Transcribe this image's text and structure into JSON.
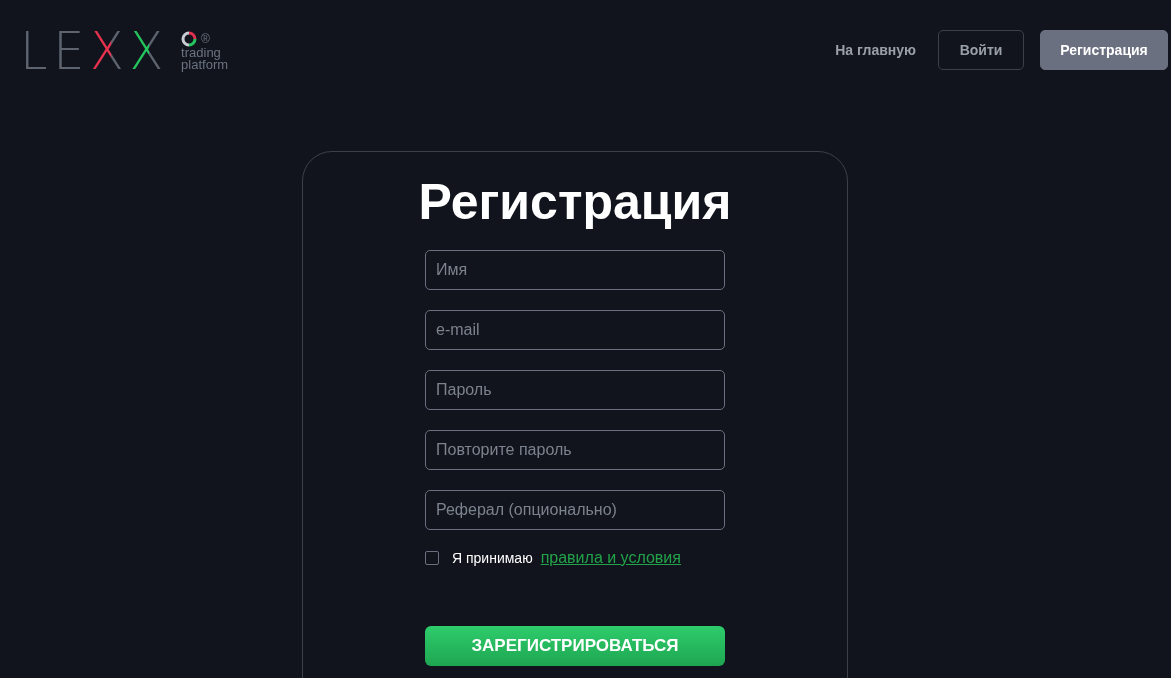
{
  "logo": {
    "wordmark": "LEXX",
    "registered": "®",
    "tagline_1": "trading",
    "tagline_2": "platform"
  },
  "nav": [
    {
      "label": "На главную",
      "kind": "link"
    },
    {
      "label": "Войти",
      "kind": "outline"
    },
    {
      "label": "Регистрация",
      "kind": "filled"
    }
  ],
  "form": {
    "title": "Регистрация",
    "fields": [
      {
        "placeholder": "Имя"
      },
      {
        "placeholder": "e-mail"
      },
      {
        "placeholder": "Пароль"
      },
      {
        "placeholder": "Повторите пароль"
      },
      {
        "placeholder": "Реферал (опционально)"
      }
    ],
    "terms": {
      "checked": false,
      "text": "Я принимаю",
      "link": "правила и условия"
    },
    "submit": "ЗАРЕГИСТРИРОВАТЬСЯ"
  }
}
